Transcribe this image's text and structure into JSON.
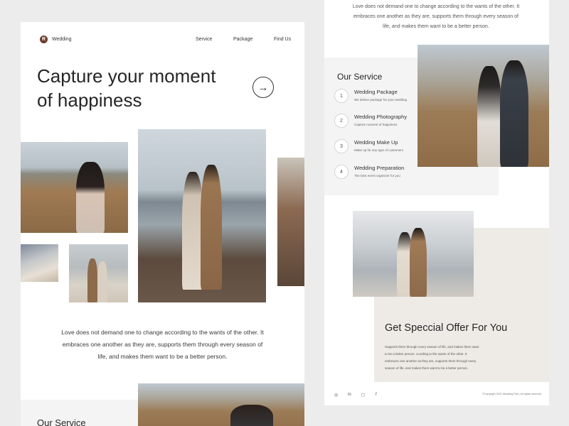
{
  "header": {
    "logo_letter": "R",
    "brand": "Wedding",
    "nav": [
      "Service",
      "Package",
      "Find Us"
    ]
  },
  "hero": {
    "title_line1": "Capture your moment",
    "title_line2": "of happiness",
    "cta_icon": "arrow-right-icon",
    "cta_glyph": "→"
  },
  "quote": {
    "line1": "Love does not demand one to change according to the wants of the other. It",
    "line2": "embraces one another as they are, supports them through every season of",
    "line3": "life, and makes them want to be a better person."
  },
  "services": {
    "title": "Our Service",
    "items": [
      {
        "num": "1",
        "name": "Wedding Package",
        "desc": "We deliver package for your wedding"
      },
      {
        "num": "2",
        "name": "Wedding Photography",
        "desc": "Capture moment of happiness"
      },
      {
        "num": "3",
        "name": "Wedding Make Up",
        "desc": "Make up for any type of customers"
      },
      {
        "num": "4",
        "name": "Wedding Preparation",
        "desc": "The best event organizer for you"
      }
    ]
  },
  "offer": {
    "title": "Get Speccial Offer For You",
    "line1": "Supports them through every season of life, and makes them want",
    "line2": "to be a better person.  ccording to the wants of the other. It",
    "line3": "embraces one another as they are, supports them through every",
    "line4": "season of life, and makes them want to be a better person."
  },
  "footer": {
    "icons": [
      "dribbble-icon",
      "linkedin-icon",
      "instagram-icon",
      "facebook-icon"
    ],
    "icon_glyphs": [
      "◎",
      "in",
      "◻",
      "f"
    ],
    "copyright": "©Copyright 2021 Wedding Plan. All rights reserved"
  },
  "colors": {
    "brand": "#6b3b2a",
    "background": "#ececec",
    "panel": "#ffffff",
    "offer_bg": "#eeebe6"
  }
}
